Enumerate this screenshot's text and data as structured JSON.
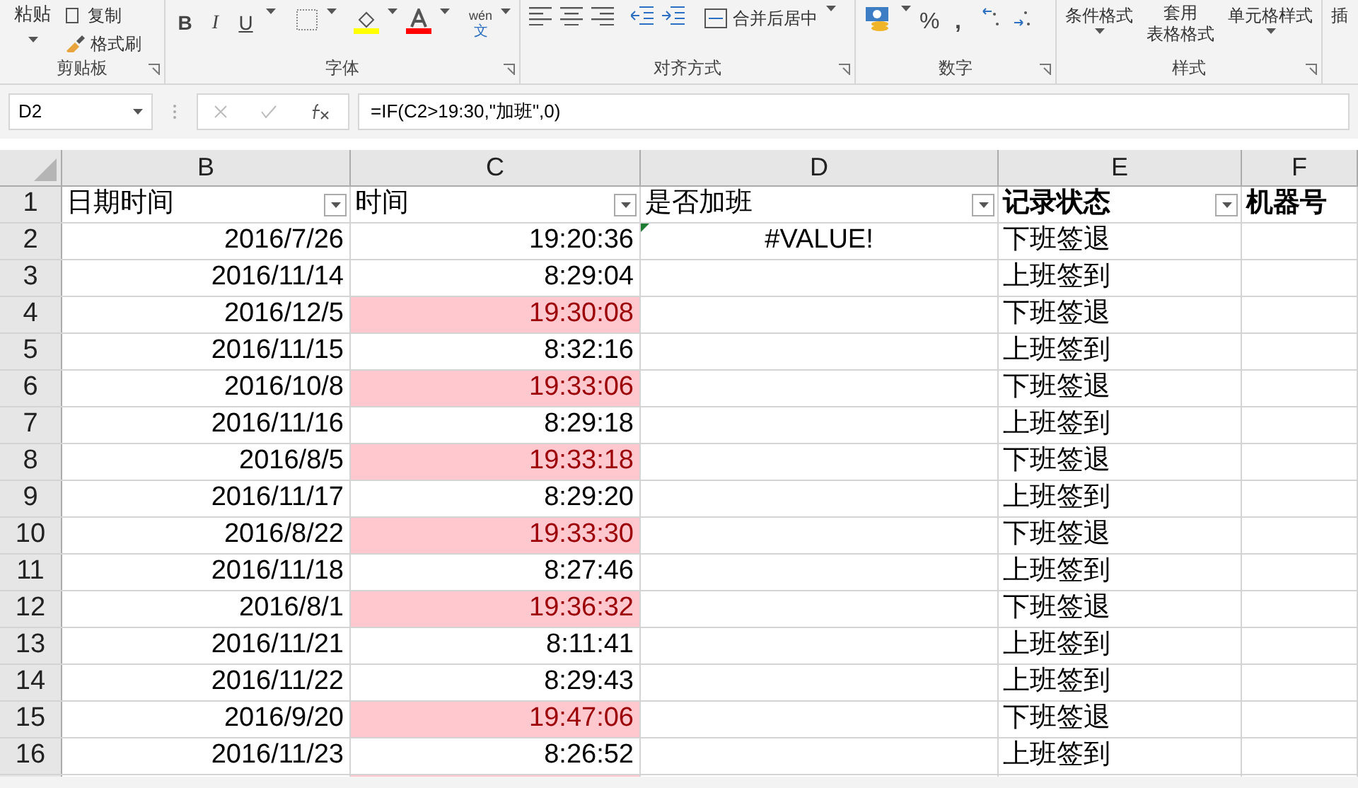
{
  "ribbon": {
    "clipboard": {
      "label": "剪贴板",
      "paste": "粘贴",
      "copy": "复制",
      "format_painter": "格式刷"
    },
    "font": {
      "label": "字体",
      "bold": "B",
      "italic": "I",
      "underline": "U",
      "phonetic_top": "wén",
      "phonetic_bottom": "文"
    },
    "alignment": {
      "label": "对齐方式",
      "merge": "合并后居中"
    },
    "number": {
      "label": "数字",
      "percent": "%",
      "comma": ","
    },
    "styles": {
      "label": "样式",
      "conditional": "条件格式",
      "table_top": "套用",
      "table_bottom": "表格格式",
      "cell_styles": "单元格样式"
    },
    "next_group": "插"
  },
  "formula_bar": {
    "name_box": "D2",
    "formula": "=IF(C2>19:30,\"加班\",0)"
  },
  "columns": [
    "B",
    "C",
    "D",
    "E",
    "F"
  ],
  "header_row": {
    "row": "1",
    "cells": [
      {
        "text": "日期时间",
        "filter": true,
        "bold": false
      },
      {
        "text": "时间",
        "filter": true,
        "bold": false
      },
      {
        "text": "是否加班",
        "filter": true,
        "bold": false
      },
      {
        "text": "记录状态",
        "filter": true,
        "bold": true
      },
      {
        "text": "机器号",
        "filter": false,
        "bold": true
      }
    ]
  },
  "rows": [
    {
      "row": "2",
      "date": "2016/7/26",
      "time": "19:20:36",
      "overtime": "#VALUE!",
      "status": "下班签退",
      "highlighted": false,
      "error_indicator": true
    },
    {
      "row": "3",
      "date": "2016/11/14",
      "time": "8:29:04",
      "status": "上班签到",
      "highlighted": false,
      "error_indicator": false
    },
    {
      "row": "4",
      "date": "2016/12/5",
      "time": "19:30:08",
      "status": "下班签退",
      "highlighted": true,
      "error_indicator": false
    },
    {
      "row": "5",
      "date": "2016/11/15",
      "time": "8:32:16",
      "status": "上班签到",
      "highlighted": false,
      "error_indicator": false
    },
    {
      "row": "6",
      "date": "2016/10/8",
      "time": "19:33:06",
      "status": "下班签退",
      "highlighted": true,
      "error_indicator": false
    },
    {
      "row": "7",
      "date": "2016/11/16",
      "time": "8:29:18",
      "status": "上班签到",
      "highlighted": false,
      "error_indicator": false
    },
    {
      "row": "8",
      "date": "2016/8/5",
      "time": "19:33:18",
      "status": "下班签退",
      "highlighted": true,
      "error_indicator": false
    },
    {
      "row": "9",
      "date": "2016/11/17",
      "time": "8:29:20",
      "status": "上班签到",
      "highlighted": false,
      "error_indicator": false
    },
    {
      "row": "10",
      "date": "2016/8/22",
      "time": "19:33:30",
      "status": "下班签退",
      "highlighted": true,
      "error_indicator": false
    },
    {
      "row": "11",
      "date": "2016/11/18",
      "time": "8:27:46",
      "status": "上班签到",
      "highlighted": false,
      "error_indicator": false
    },
    {
      "row": "12",
      "date": "2016/8/1",
      "time": "19:36:32",
      "status": "下班签退",
      "highlighted": true,
      "error_indicator": false
    },
    {
      "row": "13",
      "date": "2016/11/21",
      "time": "8:11:41",
      "status": "上班签到",
      "highlighted": false,
      "error_indicator": false
    },
    {
      "row": "14",
      "date": "2016/11/22",
      "time": "8:29:43",
      "status": "上班签到",
      "highlighted": false,
      "error_indicator": false
    },
    {
      "row": "15",
      "date": "2016/9/20",
      "time": "19:47:06",
      "status": "下班签退",
      "highlighted": true,
      "error_indicator": false
    },
    {
      "row": "16",
      "date": "2016/11/23",
      "time": "8:26:52",
      "status": "上班签到",
      "highlighted": false,
      "error_indicator": false
    },
    {
      "highlighted": true,
      "error_indicator": false
    }
  ]
}
